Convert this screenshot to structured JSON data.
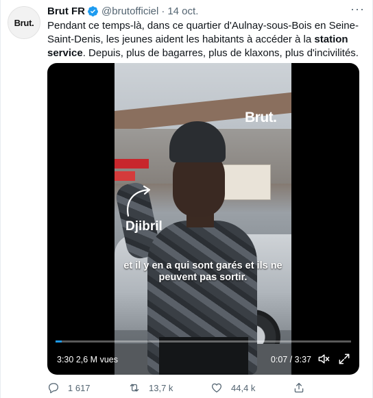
{
  "tweet": {
    "avatar_text": "Brut.",
    "author_name": "Brut FR",
    "handle": "@brutofficiel",
    "separator": "·",
    "date": "14 oct.",
    "text_part1": "Pendant ce temps-là, dans ce quartier d'Aulnay-sous-Bois en Seine-Saint-Denis, les jeunes aident les habitants à accéder à la ",
    "text_bold": "station service",
    "text_part2": ". Depuis, plus de bagarres, plus de klaxons, plus d'incivilités.",
    "more_label": "···"
  },
  "video": {
    "watermark": "Brut.",
    "name_label": "Djibril",
    "caption": "et il y en a qui sont garés et ils ne peuvent pas sortir.",
    "views": "2,6 M vues",
    "elapsed": "3:30",
    "time_display": "0:07 / 3:37",
    "progress_fraction": 0.02,
    "accent": "#1d9bf0"
  },
  "actions": {
    "reply_count": "1 617",
    "retweet_count": "13,7 k",
    "like_count": "44,4 k"
  },
  "colors": {
    "text_primary": "#0f1419",
    "text_secondary": "#536471",
    "verified": "#1d9bf0"
  }
}
